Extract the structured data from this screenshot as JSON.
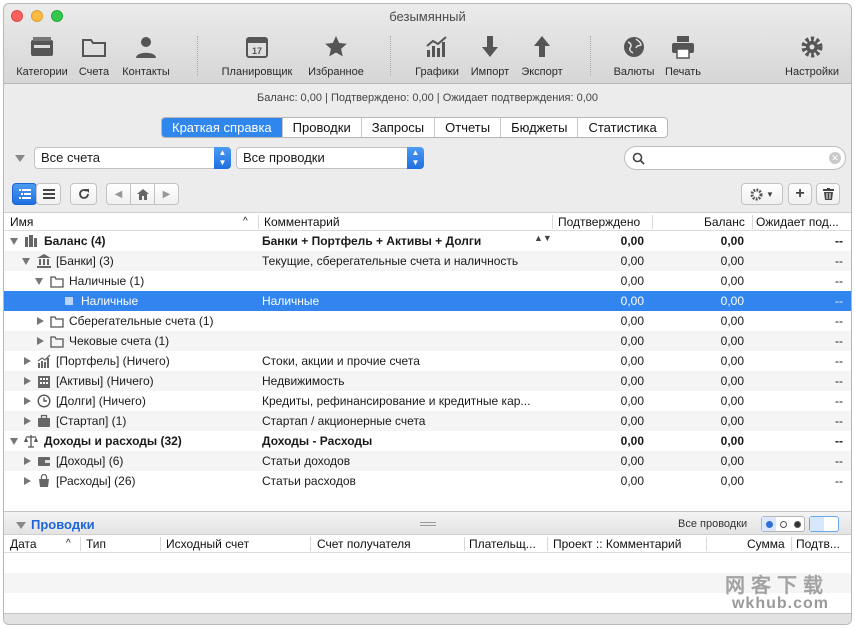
{
  "window": {
    "title": "безымянный"
  },
  "toolbar": {
    "categories": "Категории",
    "accounts": "Счета",
    "contacts": "Контакты",
    "scheduler": "Планировщик",
    "favorites": "Избранное",
    "charts": "Графики",
    "import": "Импорт",
    "export": "Экспорт",
    "currencies": "Валюты",
    "print": "Печать",
    "settings": "Настройки"
  },
  "summary": "Баланс: 0,00 | Подтверждено: 0,00 | Ожидает подтверждения: 0,00",
  "tabs": [
    {
      "label": "Краткая справка",
      "active": true
    },
    {
      "label": "Проводки",
      "active": false
    },
    {
      "label": "Запросы",
      "active": false
    },
    {
      "label": "Отчеты",
      "active": false
    },
    {
      "label": "Бюджеты",
      "active": false
    },
    {
      "label": "Статистика",
      "active": false
    }
  ],
  "filters": {
    "accounts": "Все счета",
    "transactions": "Все проводки",
    "search_value": ""
  },
  "table": {
    "columns": {
      "name": "Имя",
      "comment": "Комментарий",
      "confirmed": "Подтверждено",
      "balance": "Баланс",
      "pending": "Ожидает под..."
    },
    "rows": [
      {
        "name": "Баланс (4)",
        "comment": "Банки + Портфель + Активы + Долги",
        "confirmed": "0,00",
        "balance": "0,00",
        "pending": "--",
        "icon": "balance-icon"
      },
      {
        "name": "[Банки] (3)",
        "comment": "Текущие, сберегательные счета и наличность",
        "confirmed": "0,00",
        "balance": "0,00",
        "pending": "--",
        "icon": "bank-icon"
      },
      {
        "name": "Наличные (1)",
        "comment": "",
        "confirmed": "0,00",
        "balance": "0,00",
        "pending": "--",
        "icon": "folder-icon"
      },
      {
        "name": "Наличные",
        "comment": "Наличные",
        "confirmed": "0,00",
        "balance": "0,00",
        "pending": "--",
        "icon": "account-icon"
      },
      {
        "name": "Сберегательные счета (1)",
        "comment": "",
        "confirmed": "0,00",
        "balance": "0,00",
        "pending": "--",
        "icon": "folder-icon"
      },
      {
        "name": "Чековые счета (1)",
        "comment": "",
        "confirmed": "0,00",
        "balance": "0,00",
        "pending": "--",
        "icon": "folder-icon"
      },
      {
        "name": "[Портфель] (Ничего)",
        "comment": "Стоки, акции и прочие счета",
        "confirmed": "0,00",
        "balance": "0,00",
        "pending": "--",
        "icon": "portfolio-icon"
      },
      {
        "name": "[Активы] (Ничего)",
        "comment": "Недвижимость",
        "confirmed": "0,00",
        "balance": "0,00",
        "pending": "--",
        "icon": "assets-icon"
      },
      {
        "name": "[Долги] (Ничего)",
        "comment": "Кредиты, рефинансирование и кредитные кар...",
        "confirmed": "0,00",
        "balance": "0,00",
        "pending": "--",
        "icon": "debts-icon"
      },
      {
        "name": "[Стартап] (1)",
        "comment": "Стартап / акционерные счета",
        "confirmed": "0,00",
        "balance": "0,00",
        "pending": "--",
        "icon": "startup-icon"
      },
      {
        "name": "Доходы и расходы (32)",
        "comment": "Доходы - Расходы",
        "confirmed": "0,00",
        "balance": "0,00",
        "pending": "--",
        "icon": "scales-icon"
      },
      {
        "name": "[Доходы] (6)",
        "comment": "Статьи доходов",
        "confirmed": "0,00",
        "balance": "0,00",
        "pending": "--",
        "icon": "income-icon"
      },
      {
        "name": "[Расходы] (26)",
        "comment": "Статьи расходов",
        "confirmed": "0,00",
        "balance": "0,00",
        "pending": "--",
        "icon": "expenses-icon"
      }
    ]
  },
  "transactions_panel": {
    "title": "Проводки",
    "filter_label": "Все проводки",
    "columns": {
      "date": "Дата",
      "type": "Тип",
      "source": "Исходный счет",
      "dest": "Счет получателя",
      "payer": "Плательщ...",
      "project": "Проект :: Комментарий",
      "sum": "Сумма",
      "confirm": "Подтв..."
    }
  },
  "watermark": {
    "line1": "网客下载",
    "line2": "wkhub.com"
  },
  "colors": {
    "selection": "#3284ef",
    "accent": "#2f87ee",
    "panel_title": "#1f66d8"
  }
}
